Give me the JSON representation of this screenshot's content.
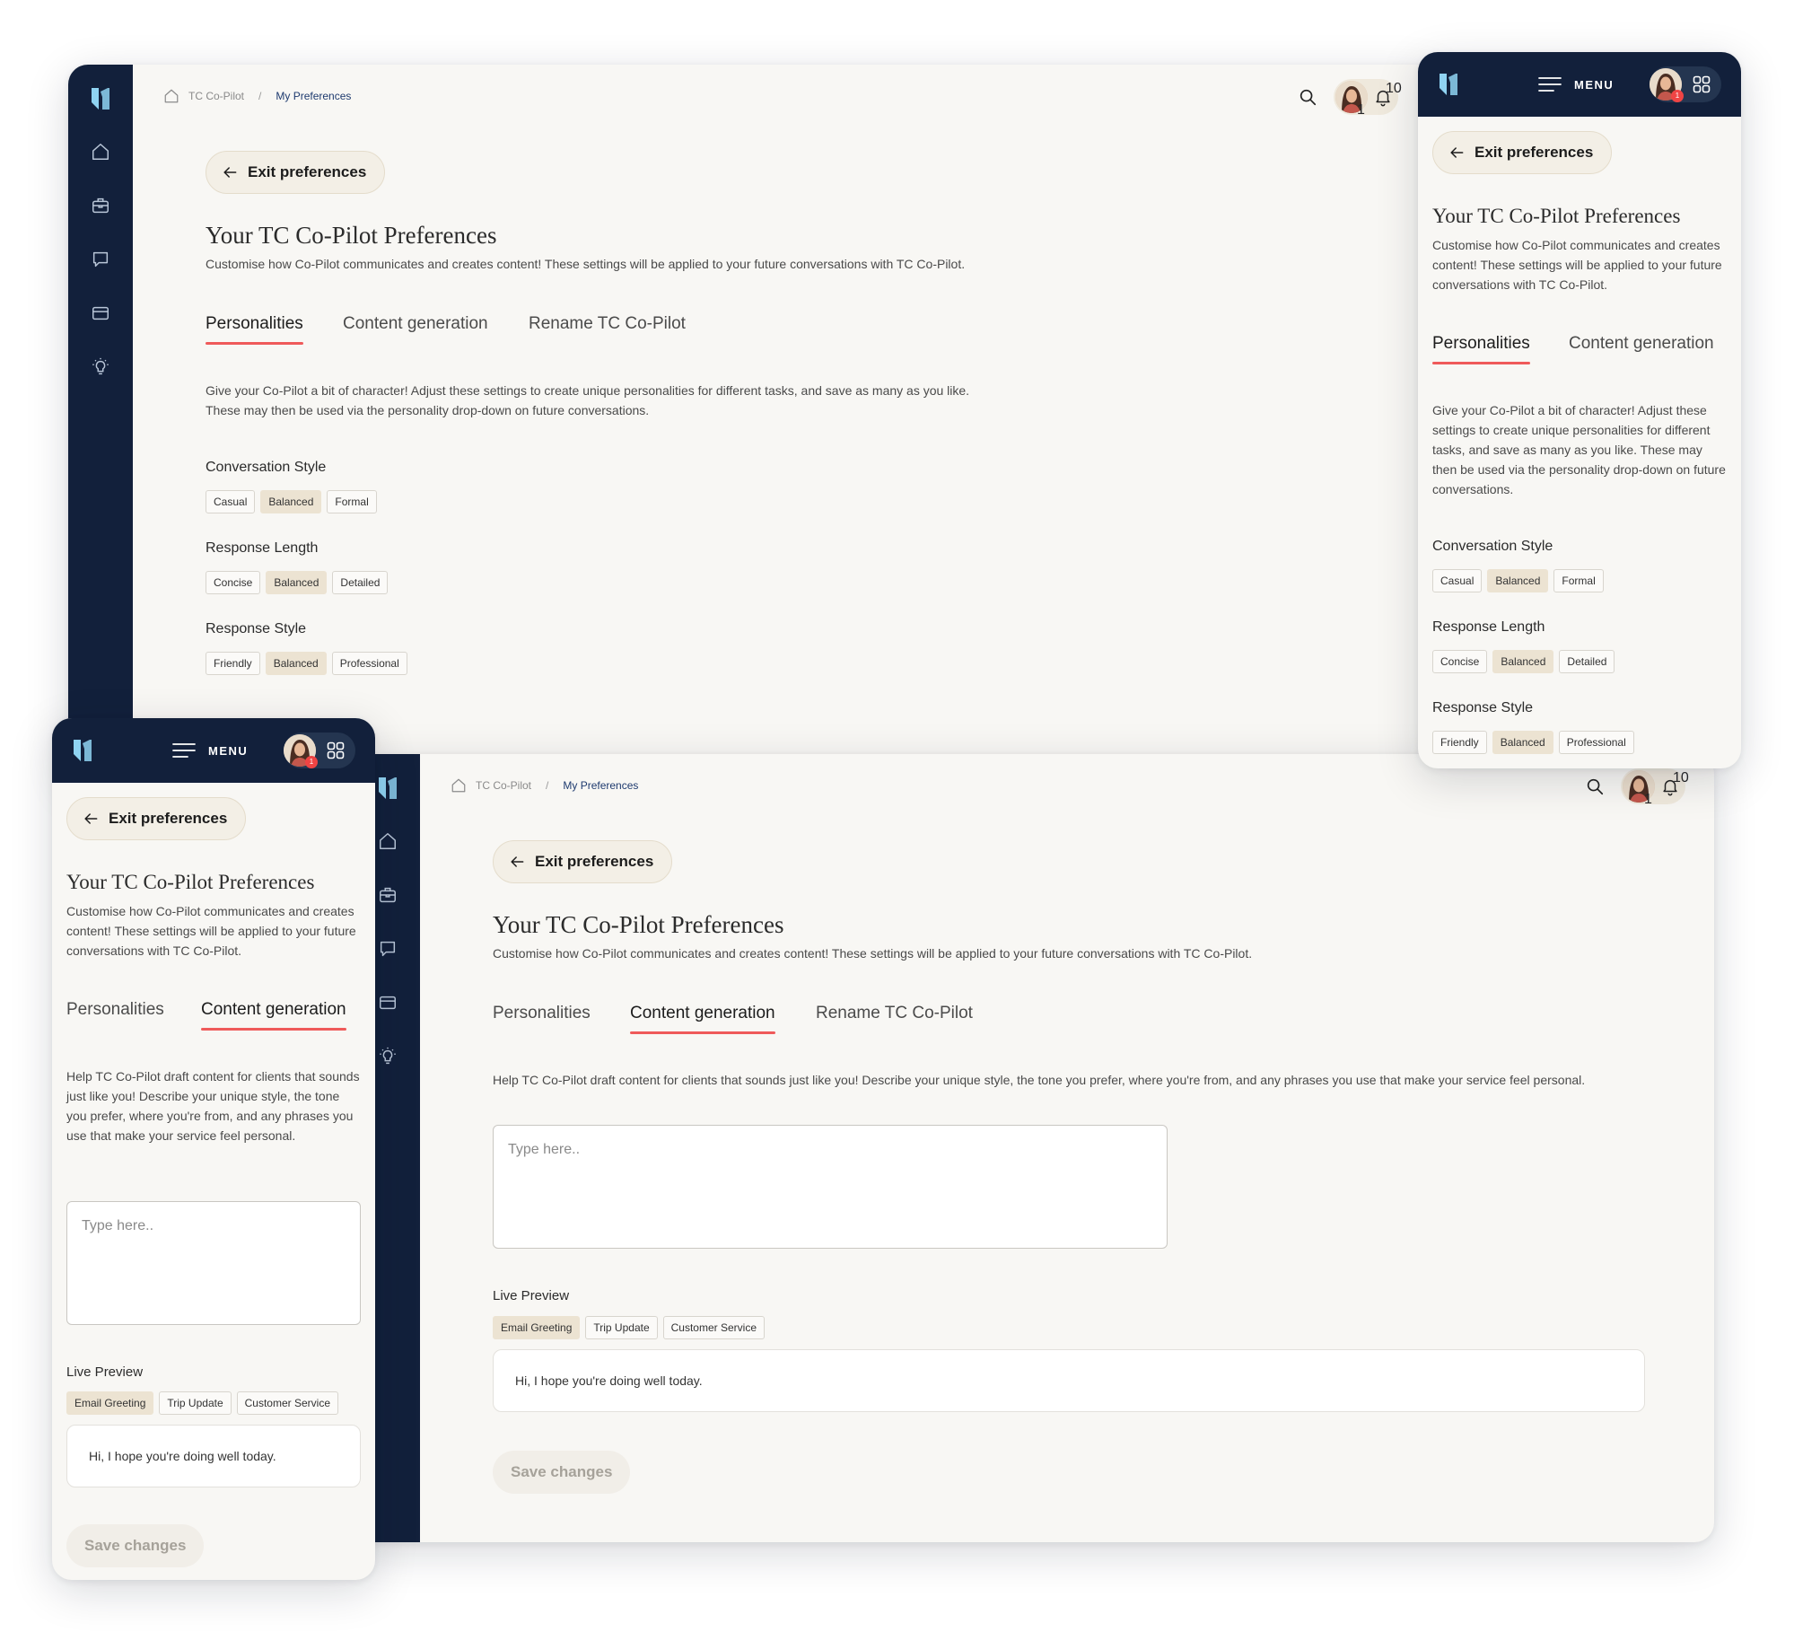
{
  "app": {
    "breadcrumb_root": "TC Co-Pilot",
    "breadcrumb_current": "My Preferences",
    "notification_count": "10",
    "avatar_badge": "1",
    "menu_label": "MENU"
  },
  "prefs": {
    "exit_label": "Exit preferences",
    "title": "Your TC Co-Pilot Preferences",
    "description": "Customise how Co-Pilot communicates and creates content! These settings will be applied to your future conversations with TC Co-Pilot.",
    "tabs": [
      "Personalities",
      "Content generation",
      "Rename TC Co-Pilot"
    ]
  },
  "personalities": {
    "intro": "Give your Co-Pilot a bit of character! Adjust these settings to create unique personalities for different tasks, and save as many as you like. These may then be used via the personality drop-down on future conversations.",
    "intro_line1": "Give your Co-Pilot a bit of character! Adjust these settings to create unique personalities for different tasks, and save as many as you like.",
    "intro_line2": "These may then be used via the personality drop-down on future conversations.",
    "groups": [
      {
        "label": "Conversation Style",
        "options": [
          "Casual",
          "Balanced",
          "Formal"
        ],
        "selected": "Balanced"
      },
      {
        "label": "Response Length",
        "options": [
          "Concise",
          "Balanced",
          "Detailed"
        ],
        "selected": "Balanced"
      },
      {
        "label": "Response Style",
        "options": [
          "Friendly",
          "Balanced",
          "Professional"
        ],
        "selected": "Balanced"
      }
    ]
  },
  "content": {
    "intro": "Help TC Co-Pilot draft content for clients that sounds just like you! Describe your unique style, the tone you prefer, where you're from, and any phrases you use that make your service feel personal.",
    "placeholder": "Type here..",
    "preview_label": "Live Preview",
    "preview_tabs": [
      "Email Greeting",
      "Trip Update",
      "Customer Service"
    ],
    "preview_selected": "Email Greeting",
    "preview_text": "Hi, I hope you're doing well today.",
    "save_label": "Save changes"
  },
  "colors": {
    "sidebar": "#12203b",
    "page_bg": "#f8f7f4",
    "accent_underline": "#ef5a5a",
    "chip_selected": "#ece3d2",
    "link": "#1e3a6e",
    "badge": "#ef4444"
  },
  "icons": [
    "logo-icon",
    "home-icon",
    "briefcase-icon",
    "chat-icon",
    "card-icon",
    "lightbulb-icon",
    "search-icon",
    "bell-icon",
    "arrow-left-icon",
    "hamburger-icon",
    "apps-grid-icon"
  ]
}
